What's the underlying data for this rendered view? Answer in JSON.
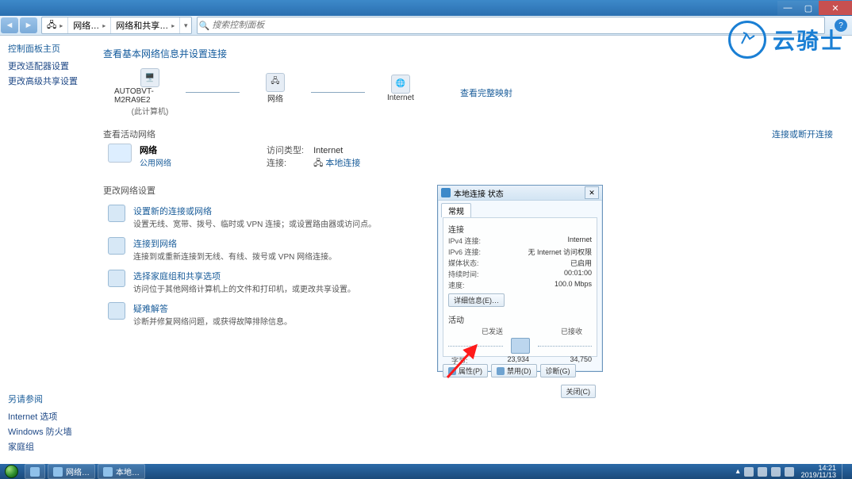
{
  "titlebar": {
    "min": "—",
    "max": "▢",
    "close": "✕"
  },
  "nav": {
    "crumb1": "网络…",
    "crumb2": "网络和共享…",
    "search_placeholder": "搜索控制面板",
    "help": "?"
  },
  "sidebar": {
    "header": "控制面板主页",
    "links": [
      "更改适配器设置",
      "更改高级共享设置"
    ],
    "seealso_hdr": "另请参阅",
    "seealso": [
      "Internet 选项",
      "Windows 防火墙",
      "家庭组"
    ]
  },
  "page": {
    "h1": "查看基本网络信息并设置连接",
    "map": {
      "node1": "AUTOBVT-M2RA9E2",
      "node1_sub": "(此计算机)",
      "node2": "网络",
      "node3": "Internet",
      "link": "查看完整映射"
    },
    "active_hdr": "查看活动网络",
    "active_link": "连接或断开连接",
    "net": {
      "name": "网络",
      "type": "公用网络"
    },
    "access_k": "访问类型:",
    "access_v": "Internet",
    "conn_k": "连接:",
    "conn_v": "本地连接",
    "change_hdr": "更改网络设置",
    "tasks": [
      {
        "t": "设置新的连接或网络",
        "d": "设置无线、宽带、拨号、临时或 VPN 连接；或设置路由器或访问点。"
      },
      {
        "t": "连接到网络",
        "d": "连接到或重新连接到无线、有线、拨号或 VPN 网络连接。"
      },
      {
        "t": "选择家庭组和共享选项",
        "d": "访问位于其他网络计算机上的文件和打印机，或更改共享设置。"
      },
      {
        "t": "疑难解答",
        "d": "诊断并修复网络问题，或获得故障排除信息。"
      }
    ]
  },
  "dlg": {
    "title": "本地连接 状态",
    "tab": "常规",
    "grp_conn": "连接",
    "rows": [
      {
        "k": "IPv4 连接:",
        "v": "Internet"
      },
      {
        "k": "IPv6 连接:",
        "v": "无 Internet 访问权限"
      },
      {
        "k": "媒体状态:",
        "v": "已启用"
      },
      {
        "k": "持续时间:",
        "v": "00:01:00"
      },
      {
        "k": "速度:",
        "v": "100.0 Mbps"
      }
    ],
    "details": "详细信息(E)…",
    "grp_act": "活动",
    "sent": "已发送",
    "recv": "已接收",
    "bytes_k": "字节:",
    "bytes_sent": "23,934",
    "bytes_recv": "34,750",
    "btn_props": "属性(P)",
    "btn_disable": "禁用(D)",
    "btn_diag": "诊断(G)",
    "btn_close": "关闭(C)"
  },
  "watermark": "云骑士",
  "taskbar": {
    "btns": [
      "网络…",
      "本地…"
    ],
    "time": "14:21",
    "date": "2019/11/13",
    "tray_chevron": "▴"
  }
}
